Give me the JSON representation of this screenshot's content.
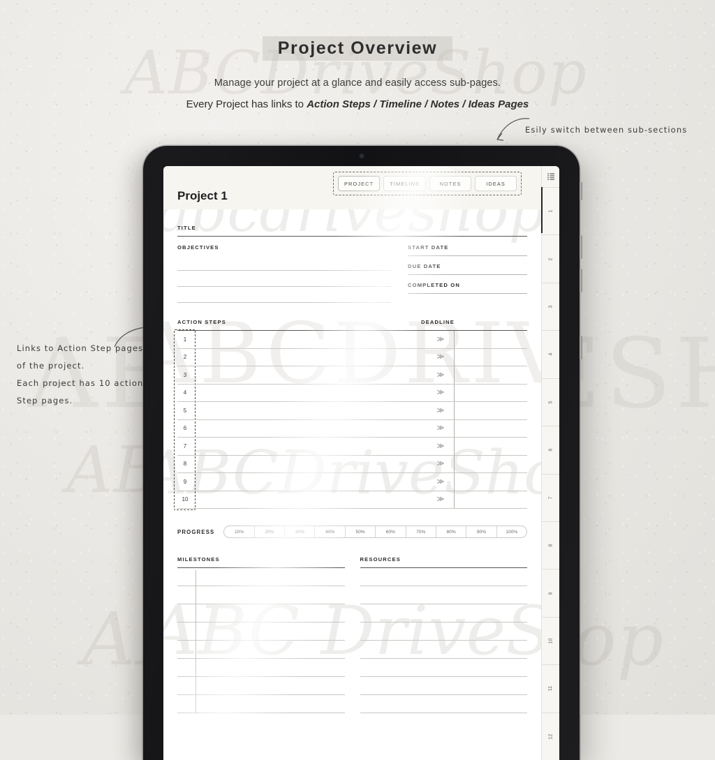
{
  "heading": {
    "title": "Project Overview",
    "subtitle_1": "Manage your project at a glance and easily access sub-pages.",
    "subtitle_2_prefix": "Every Project has links to ",
    "subtitle_2_emphasis": "Action Steps / Timeline / Notes / Ideas Pages"
  },
  "annotations": {
    "right_note": "Esily switch between sub-sections",
    "left_note": "Links to Action Step pages\nof the project.\nEach project has 10 action\nStep pages."
  },
  "watermarks": {
    "top": "ABCDriveShop",
    "mid": "ABCDRIVESHOP",
    "bottom": "ABCDriveShop",
    "bottom2": "ABC DriveShop",
    "page_1": "abcdriveshop",
    "page_2": "ABCDRIVESHOP",
    "page_3": "ABCDriveShop",
    "page_4": "ABC DriveShop"
  },
  "tablet": {
    "header": {
      "project_name": "Project 1",
      "tabs": [
        {
          "label": "PROJECT",
          "active": true
        },
        {
          "label": "TIMELINE",
          "active": false
        },
        {
          "label": "NOTES",
          "active": false
        },
        {
          "label": "IDEAS",
          "active": false
        }
      ]
    },
    "form": {
      "title_label": "TITLE",
      "objectives_label": "OBJECTIVES",
      "objectives_lines": 3,
      "dates": [
        {
          "label": "START DATE",
          "value": ""
        },
        {
          "label": "DUE DATE",
          "value": ""
        },
        {
          "label": "COMPLETED ON",
          "value": ""
        }
      ]
    },
    "action_steps": {
      "heading": "ACTION STEPS",
      "deadline_heading": "DEADLINE",
      "chevron_icon": "≫",
      "rows": [
        {
          "number": "1",
          "text": "",
          "deadline": ""
        },
        {
          "number": "2",
          "text": "",
          "deadline": ""
        },
        {
          "number": "3",
          "text": "",
          "deadline": ""
        },
        {
          "number": "4",
          "text": "",
          "deadline": ""
        },
        {
          "number": "5",
          "text": "",
          "deadline": ""
        },
        {
          "number": "6",
          "text": "",
          "deadline": ""
        },
        {
          "number": "7",
          "text": "",
          "deadline": ""
        },
        {
          "number": "8",
          "text": "",
          "deadline": ""
        },
        {
          "number": "9",
          "text": "",
          "deadline": ""
        },
        {
          "number": "10",
          "text": "",
          "deadline": ""
        }
      ]
    },
    "progress": {
      "label": "PROGRESS",
      "steps": [
        "10%",
        "20%",
        "30%",
        "40%",
        "50%",
        "60%",
        "70%",
        "80%",
        "90%",
        "100%"
      ],
      "selected": null
    },
    "milestones": {
      "label": "MILESTONES",
      "lines": 8
    },
    "resources": {
      "label": "RESOURCES",
      "lines": 8
    },
    "sidebar": {
      "grid_icon": "grid-icon",
      "tabs": [
        "1",
        "2",
        "3",
        "4",
        "5",
        "6",
        "7",
        "8",
        "9",
        "10",
        "11",
        "12"
      ],
      "active": "1"
    }
  },
  "colors": {
    "page_bg": "#ffffff",
    "header_band": "#f6f5f0",
    "sidebar_bg": "#f7f6f2",
    "rule_strong": "#56544e",
    "rule_light": "#c9c7c2",
    "bezel": "#141416",
    "backdrop": "#eceae6",
    "text": "#2a2a2a"
  }
}
